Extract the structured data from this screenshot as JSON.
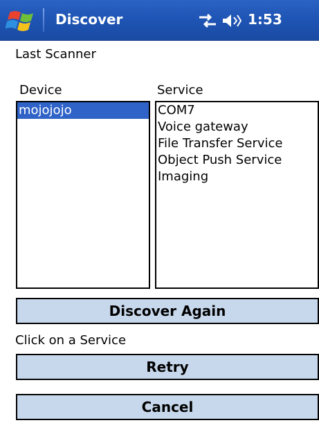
{
  "titlebar": {
    "title": "Discover",
    "clock": "1:53",
    "start_icon": "windows-flag-icon",
    "network_icon": "network-connectivity-icon",
    "volume_icon": "speaker-volume-icon"
  },
  "header": {
    "last_scanner": "Last Scanner"
  },
  "device": {
    "label": "Device",
    "items": [
      "mojojojo"
    ],
    "selected": "mojojojo"
  },
  "service": {
    "label": "Service",
    "items": [
      "COM7",
      "Voice gateway",
      "File Transfer Service",
      "Object Push Service",
      "Imaging"
    ]
  },
  "buttons": {
    "discover_again": "Discover Again",
    "retry": "Retry",
    "cancel": "Cancel"
  },
  "status": {
    "message": "Click on a Service"
  },
  "colors": {
    "titlebar": "#1f55b5",
    "selection": "#2f63c8",
    "button": "#c8d8ec"
  }
}
